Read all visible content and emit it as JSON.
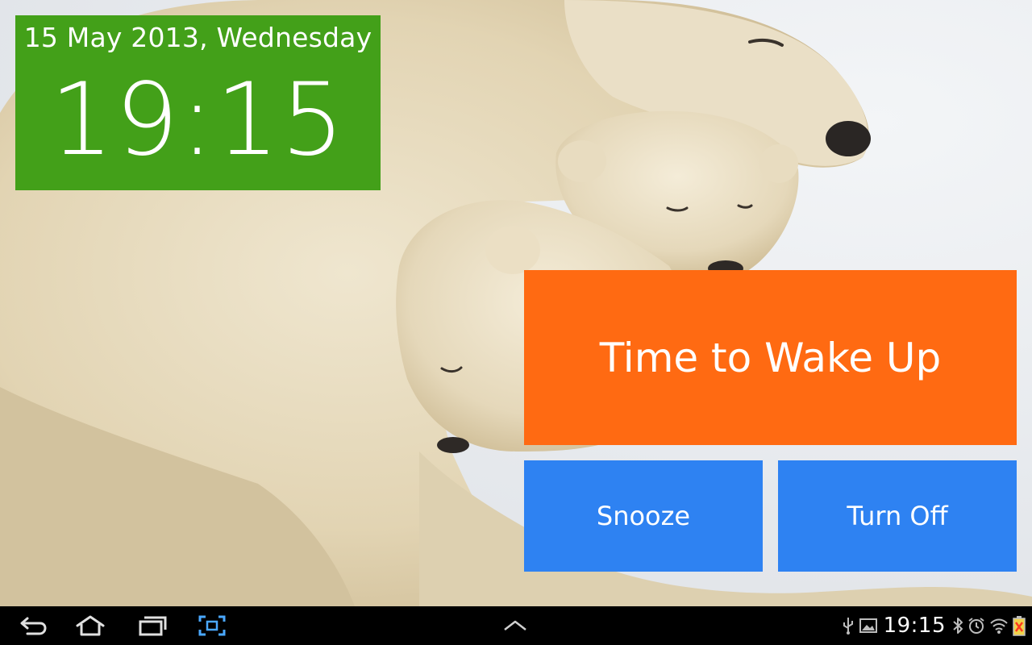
{
  "clock": {
    "date": "15 May 2013, Wednesday",
    "time": "19:15"
  },
  "alarm": {
    "message": "Time to Wake Up",
    "snooze_label": "Snooze",
    "turn_off_label": "Turn Off"
  },
  "system_bar": {
    "nav_icons": [
      "back-icon",
      "home-icon",
      "recent-apps-icon",
      "screenshot-icon",
      "chevron-up-icon"
    ],
    "status_icons_left": [
      "usb-icon",
      "gallery-icon"
    ],
    "time": "19:15",
    "status_icons_right": [
      "bluetooth-icon",
      "alarm-clock-icon",
      "wifi-icon",
      "battery-charging-icon"
    ]
  },
  "colors": {
    "clock_background": "#43a019",
    "alarm_message_background": "#ff6a12",
    "alarm_button_background": "#2e82f2",
    "system_bar_background": "#000000",
    "battery_accent": "#ff3b1f",
    "battery_fill": "#f1d34a"
  },
  "wallpaper": {
    "subject": "polar-bears-image"
  }
}
